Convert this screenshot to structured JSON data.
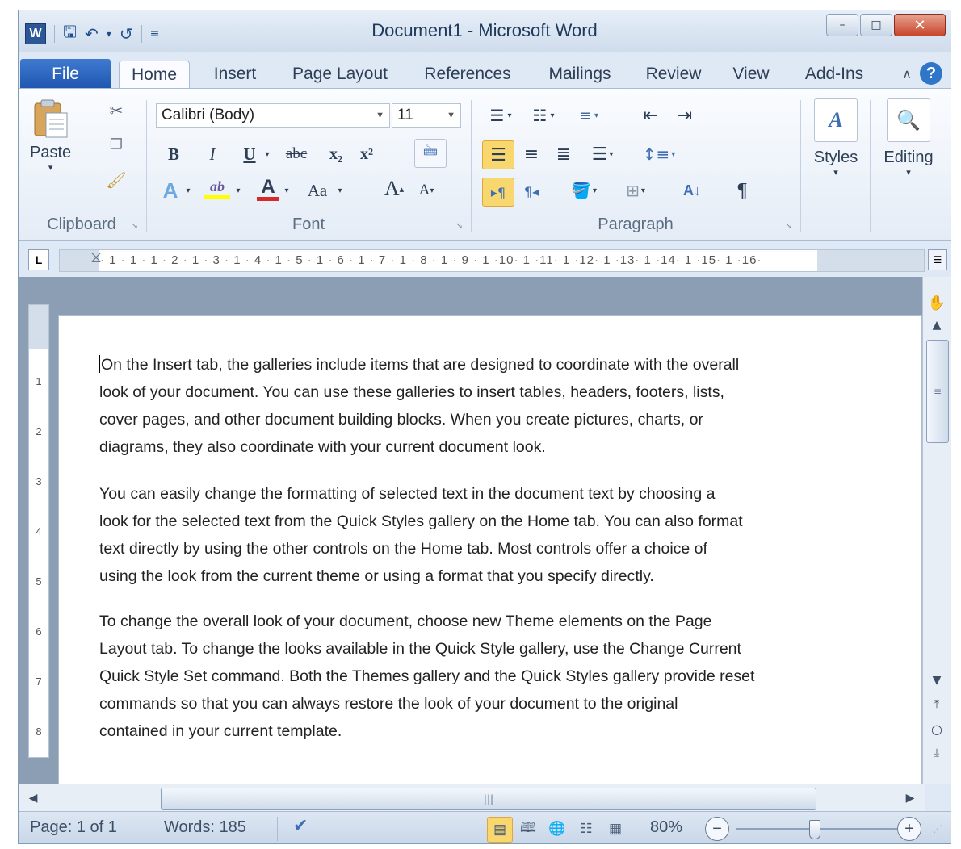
{
  "window": {
    "title": "Document1 - Microsoft Word",
    "app_letter": "W",
    "qat_icons": [
      "save-icon",
      "undo-icon",
      "redo-icon",
      "customize-icon"
    ]
  },
  "tabs": [
    {
      "label": "File"
    },
    {
      "label": "Home"
    },
    {
      "label": "Insert"
    },
    {
      "label": "Page Layout"
    },
    {
      "label": "References"
    },
    {
      "label": "Mailings"
    },
    {
      "label": "Review"
    },
    {
      "label": "View"
    },
    {
      "label": "Add-Ins"
    }
  ],
  "active_tab": "Home",
  "ribbon": {
    "clipboard": {
      "label": "Clipboard",
      "paste_label": "Paste"
    },
    "font": {
      "label": "Font",
      "font_name": "Calibri (Body)",
      "font_size": "11",
      "bold": "B",
      "italic": "I",
      "underline": "U",
      "strike": "abc",
      "change_case": "Aa",
      "grow": "A",
      "shrink": "A"
    },
    "paragraph": {
      "label": "Paragraph",
      "show_marks": "¶",
      "sort": "A↓"
    },
    "styles": {
      "label": "Styles"
    },
    "editing": {
      "label": "Editing"
    }
  },
  "ruler": {
    "tab_selector": "L",
    "ticks": "· 1 · 1 · 1 · 2 · 1 · 3 · 1 · 4 · 1 · 5 · 1 · 6 · 1 · 7 · 1 · 8 · 1 · 9 · 1 ·10· 1 ·11· 1 ·12· 1 ·13· 1 ·14· 1 ·15· 1 ·16·",
    "vertical_ticks": [
      "1",
      "2",
      "3",
      "4",
      "5",
      "6",
      "7",
      "8"
    ]
  },
  "document": {
    "paragraphs": [
      [
        "On the Insert tab, the galleries include items that are designed to coordinate with the overall",
        "look of your document. You can use these galleries to insert tables, headers, footers, lists,",
        "cover pages, and other document building blocks. When you create pictures, charts, or",
        "diagrams, they also coordinate with your current document look."
      ],
      [
        "You can easily change the formatting of selected text in the document text by choosing a",
        "look for the selected text from the Quick Styles gallery on the Home tab. You can also format",
        "text directly by using the other controls on the Home tab. Most controls offer a choice of",
        "using the look from the current theme or using a format that you specify directly."
      ],
      [
        "To change the overall look of your document, choose new Theme elements on the Page",
        "Layout tab. To change the looks available in the Quick Style gallery, use the Change Current",
        "Quick Style Set command. Both the Themes gallery and the Quick Styles gallery provide reset",
        "commands so that you can always restore the look of your document to the original",
        "contained in your current template."
      ]
    ]
  },
  "status": {
    "page": "Page: 1 of 1",
    "words": "Words: 185",
    "zoom": "80%",
    "zoom_fraction": 0.45
  },
  "colors": {
    "file_tab": "#1d55b0",
    "highlight": "#f9d76f",
    "font_color": "#d42a2a",
    "highlight_color": "#ffff00"
  }
}
